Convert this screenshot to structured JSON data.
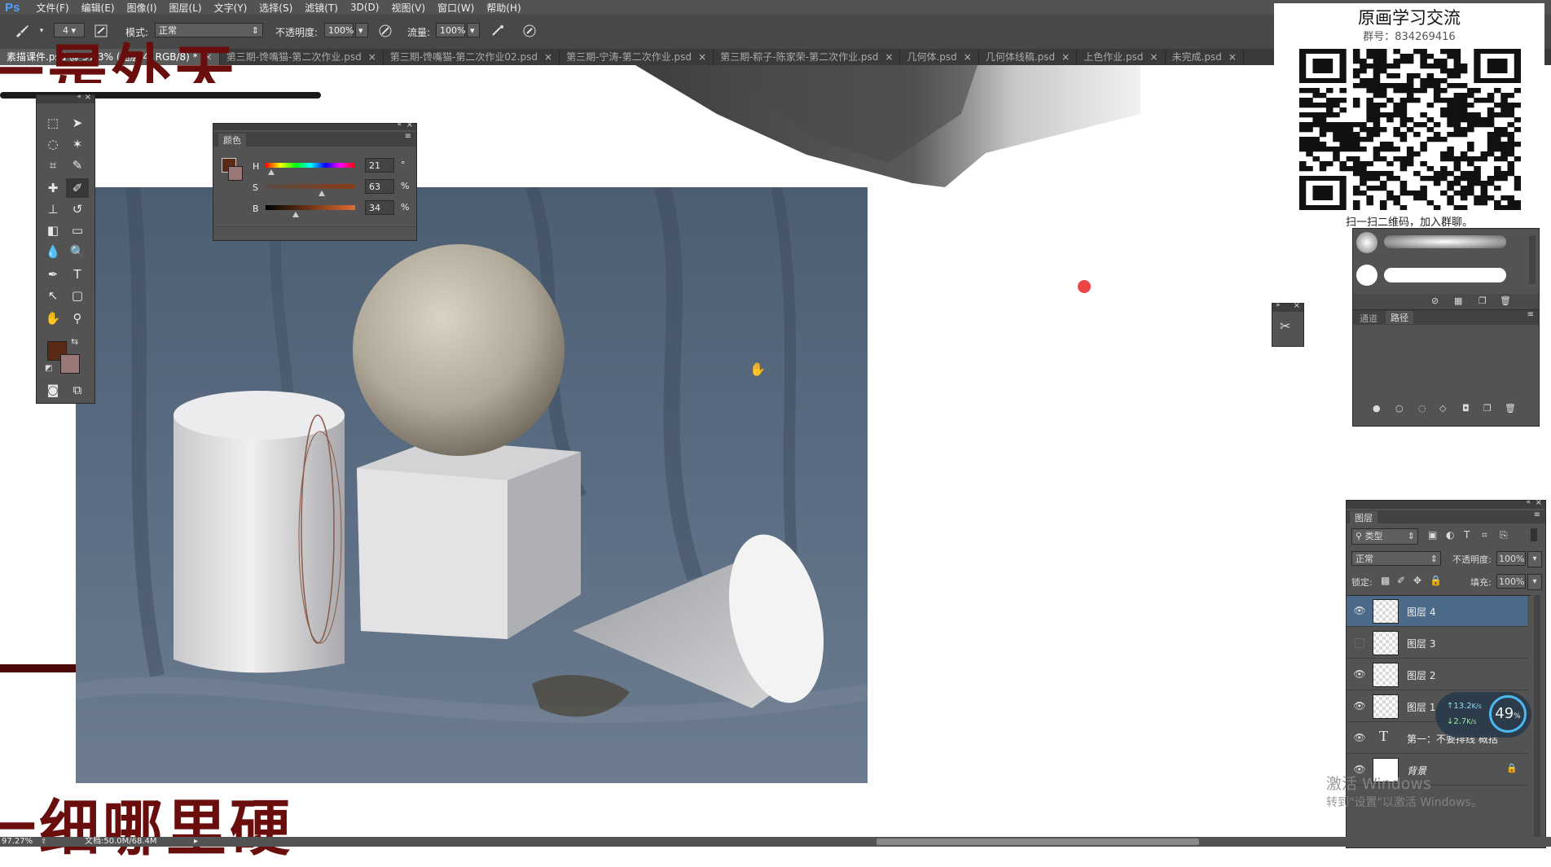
{
  "app": {
    "logo": "Ps",
    "menu": [
      "文件(F)",
      "编辑(E)",
      "图像(I)",
      "图层(L)",
      "文字(Y)",
      "选择(S)",
      "滤镜(T)",
      "3D(D)",
      "视图(V)",
      "窗口(W)",
      "帮助(H)"
    ]
  },
  "options": {
    "brush_size": "4",
    "mode_label": "模式:",
    "mode_value": "正常",
    "opacity_label": "不透明度:",
    "opacity_value": "100%",
    "flow_label": "流量:",
    "flow_value": "100%"
  },
  "tabs": [
    {
      "label": "素描课件.psd @ 97.3% (图层 4, RGB/8) *"
    },
    {
      "label": "第三期-馋嘴猫-第二次作业.psd"
    },
    {
      "label": "第三期-馋嘴猫-第二次作业02.psd"
    },
    {
      "label": "第三期-宁涛-第二次作业.psd"
    },
    {
      "label": "第三期-粽子-陈家荣-第二次作业.psd"
    },
    {
      "label": "几何体.psd"
    },
    {
      "label": "几何体线稿.psd"
    },
    {
      "label": "上色作业.psd"
    },
    {
      "label": "未完成.psd"
    }
  ],
  "canvas": {
    "top_text": "一是外天",
    "bottom_text": "一细哪里硬"
  },
  "color_panel": {
    "title": "颜色",
    "h_label": "H",
    "h_value": "21",
    "h_unit": "°",
    "h_fraction": 0.06,
    "s_label": "S",
    "s_value": "63",
    "s_unit": "%",
    "s_fraction": 0.63,
    "b_label": "B",
    "b_value": "34",
    "b_unit": "%",
    "b_fraction": 0.34,
    "foreground": "#5a2a15",
    "background": "#9a7777"
  },
  "qr_overlay": {
    "title": "原画学习交流",
    "group": "群号：834269416",
    "caption": "扫一扫二维码，加入群聊。"
  },
  "paths_panel": {
    "tab_channels": "通道",
    "tab_paths": "路径"
  },
  "layers_panel": {
    "title": "图层",
    "filter_value": "类型",
    "blend_value": "正常",
    "opacity_label": "不透明度:",
    "opacity_value": "100%",
    "lock_label": "锁定:",
    "fill_label": "填充:",
    "fill_value": "100%",
    "layers": [
      {
        "name": "图层 4",
        "visible": true,
        "selected": true,
        "type": "raster"
      },
      {
        "name": "图层 3",
        "visible": false,
        "selected": false,
        "type": "raster"
      },
      {
        "name": "图层 2",
        "visible": true,
        "selected": false,
        "type": "raster"
      },
      {
        "name": "图层 1",
        "visible": true,
        "selected": false,
        "type": "raster"
      },
      {
        "name": "第一：不要排线 概括",
        "visible": true,
        "selected": false,
        "type": "text"
      },
      {
        "name": "背景",
        "visible": true,
        "selected": false,
        "type": "background"
      }
    ]
  },
  "net_widget": {
    "up": "13.2",
    "down": "2.7",
    "unit": "K/s",
    "percent": "49",
    "percent_sign": "%"
  },
  "watermark": {
    "line1": "激活 Windows",
    "line2": "转到\"设置\"以激活 Windows。"
  },
  "status": {
    "zoom": "97.27%",
    "doc": "文档:50.0M/68.4M"
  }
}
